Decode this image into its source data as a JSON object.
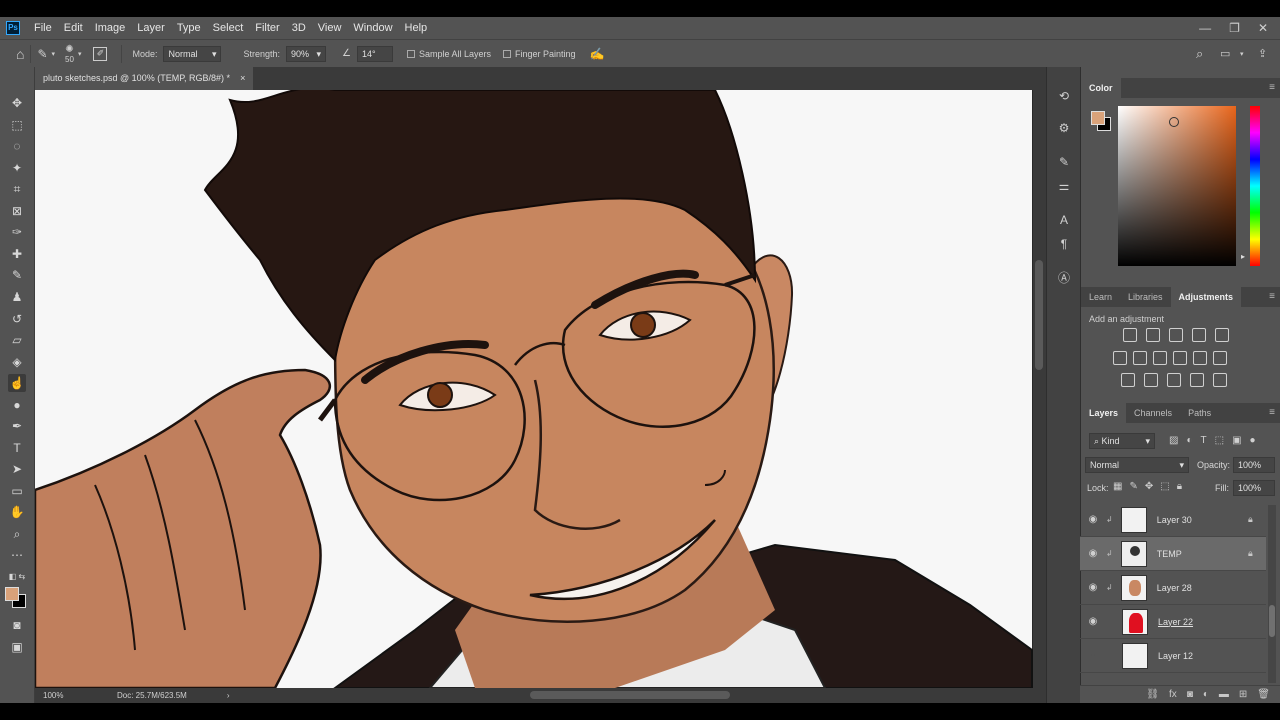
{
  "app": {
    "logo": "Ps"
  },
  "menu": [
    "File",
    "Edit",
    "Image",
    "Layer",
    "Type",
    "Select",
    "Filter",
    "3D",
    "View",
    "Window",
    "Help"
  ],
  "window_controls": [
    "—",
    "❐",
    "✕"
  ],
  "options": {
    "brush_size": "50",
    "mode_label": "Mode:",
    "mode_value": "Normal",
    "strength_label": "Strength:",
    "strength_value": "90%",
    "angle_value": "14°",
    "sample_all_layers": "Sample All Layers",
    "finger_painting": "Finger Painting"
  },
  "document": {
    "tab_title": "pluto sketches.psd @ 100% (TEMP, RGB/8#) *",
    "tab_close": "×",
    "zoom": "100%",
    "doc_info": "Doc: 25.7M/623.5M"
  },
  "colors": {
    "foreground": "#d9a27a",
    "background": "#000000",
    "accent": "#31a8ff"
  },
  "color_panel": {
    "title": "Color"
  },
  "learn_panel": {
    "tabs": [
      "Learn",
      "Libraries",
      "Adjustments"
    ],
    "active_tab": "Adjustments",
    "add_adjustment": "Add an adjustment"
  },
  "layers_panel": {
    "tabs": [
      "Layers",
      "Channels",
      "Paths"
    ],
    "active_tab": "Layers",
    "filter_kind": "Kind",
    "blend_mode": "Normal",
    "opacity_label": "Opacity:",
    "opacity_value": "100%",
    "lock_label": "Lock:",
    "fill_label": "Fill:",
    "fill_value": "100%",
    "layers": [
      {
        "name": "Layer 30",
        "visible": true,
        "locked": true,
        "selected": false,
        "thumb": "white"
      },
      {
        "name": "TEMP",
        "visible": true,
        "locked": true,
        "selected": true,
        "thumb": "face-sketch"
      },
      {
        "name": "Layer 28",
        "visible": true,
        "locked": false,
        "selected": false,
        "thumb": "skin"
      },
      {
        "name": "Layer 22",
        "visible": true,
        "locked": false,
        "selected": false,
        "thumb": "red-figure"
      },
      {
        "name": "Layer 12",
        "visible": false,
        "locked": false,
        "selected": false,
        "thumb": "white"
      }
    ]
  }
}
